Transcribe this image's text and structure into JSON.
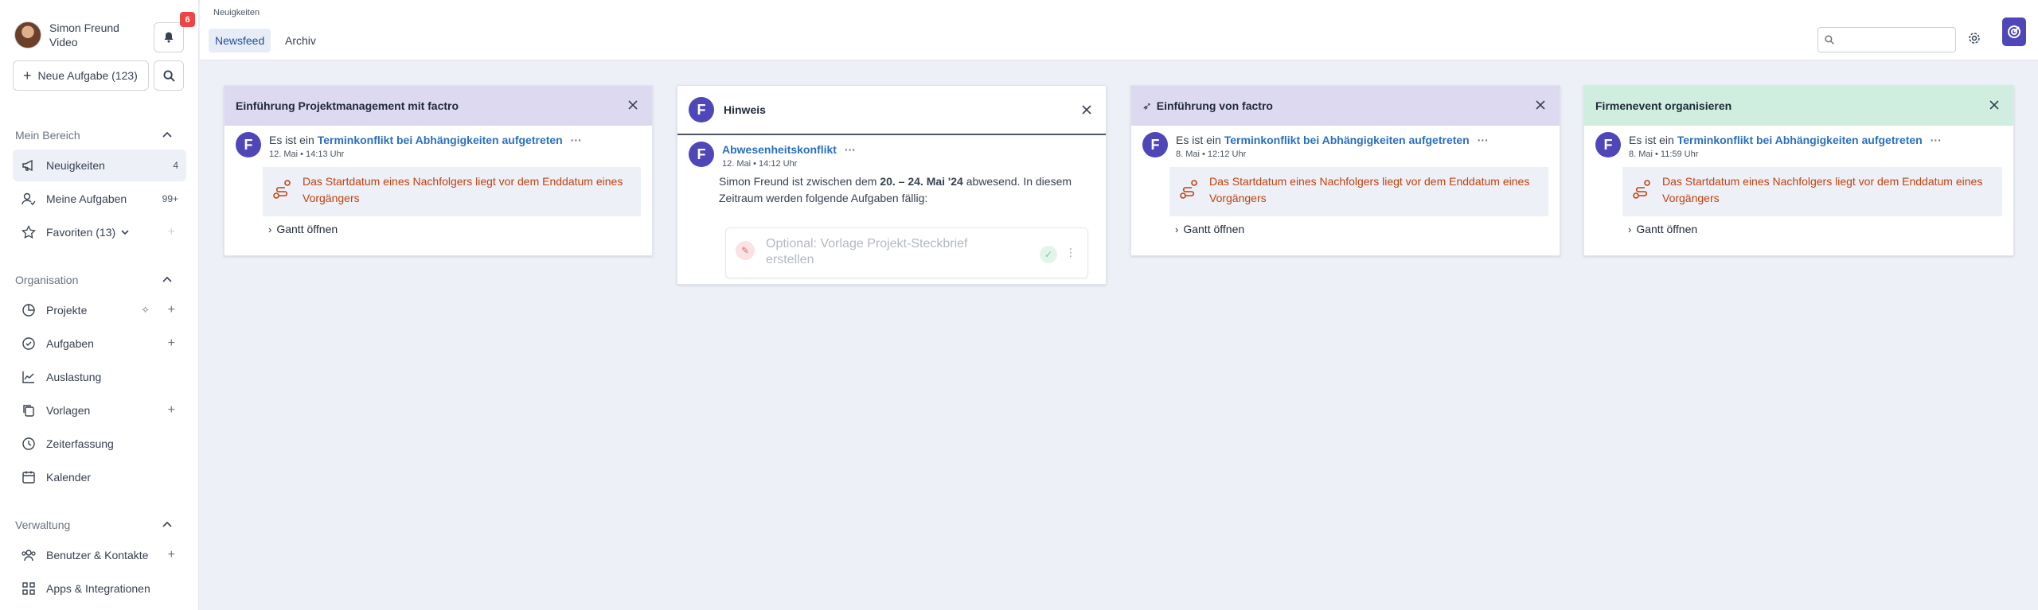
{
  "user": {
    "name": "Simon Freund",
    "subtitle": "Video"
  },
  "notifications": {
    "count": "6"
  },
  "new_task": {
    "label": "Neue Aufgabe (123)"
  },
  "sections": {
    "mein_bereich": "Mein Bereich",
    "organisation": "Organisation",
    "verwaltung": "Verwaltung"
  },
  "nav": {
    "neuigkeiten": {
      "label": "Neuigkeiten",
      "count": "4"
    },
    "meine_aufgaben": {
      "label": "Meine Aufgaben",
      "count": "99+"
    },
    "favoriten": {
      "label": "Favoriten (13)"
    },
    "projekte": {
      "label": "Projekte"
    },
    "aufgaben": {
      "label": "Aufgaben"
    },
    "auslastung": {
      "label": "Auslastung"
    },
    "vorlagen": {
      "label": "Vorlagen"
    },
    "zeiterfassung": {
      "label": "Zeiterfassung"
    },
    "kalender": {
      "label": "Kalender"
    },
    "benutzer": {
      "label": "Benutzer & Kontakte"
    },
    "apps": {
      "label": "Apps & Integrationen"
    }
  },
  "header": {
    "breadcrumb": "Neuigkeiten",
    "tabs": [
      "Newsfeed",
      "Archiv"
    ]
  },
  "cards": [
    {
      "title": "Einführung Projektmanagement mit factro",
      "prefix": "Es ist ein ",
      "link": "Terminkonflikt bei Abhängigkeiten aufgetreten",
      "date": "12. Mai • 14:13 Uhr",
      "warning": "Das Startdatum eines Nachfolgers liegt vor dem Enddatum eines Vorgängers",
      "gantt": "Gantt öffnen"
    },
    {
      "title": "Einführung von factro",
      "prefix": "Es ist ein ",
      "link": "Terminkonflikt bei Abhängigkeiten aufgetreten",
      "date": "8. Mai • 12:12 Uhr",
      "warning": "Das Startdatum eines Nachfolgers liegt vor dem Enddatum eines Vorgängers",
      "gantt": "Gantt öffnen"
    },
    {
      "title": "Firmenevent organisieren",
      "prefix": "Es ist ein ",
      "link": "Terminkonflikt bei Abhängigkeiten aufgetreten",
      "date": "8. Mai • 11:59 Uhr",
      "warning": "Das Startdatum eines Nachfolgers liegt vor dem Enddatum eines Vorgängers",
      "gantt": "Gantt öffnen"
    }
  ],
  "hinweis": {
    "title": "Hinweis",
    "link": "Abwesenheitskonflikt",
    "date": "12. Mai • 14:12 Uhr",
    "text_a": "Simon Freund ist zwischen dem ",
    "text_bold": "20. – 24. Mai '24",
    "text_b": " abwesend. In diesem Zeitraum werden folgende Aufgaben fällig:",
    "task": "Optional: Vorlage Projekt-Steckbrief erstellen"
  },
  "avatar_letter": "F",
  "colors": {
    "accent": "#4f46b8",
    "link": "#2a6fbf",
    "warning": "#c2410c",
    "purple_head": "#ddd9f1",
    "green_head": "#cfeee0"
  }
}
